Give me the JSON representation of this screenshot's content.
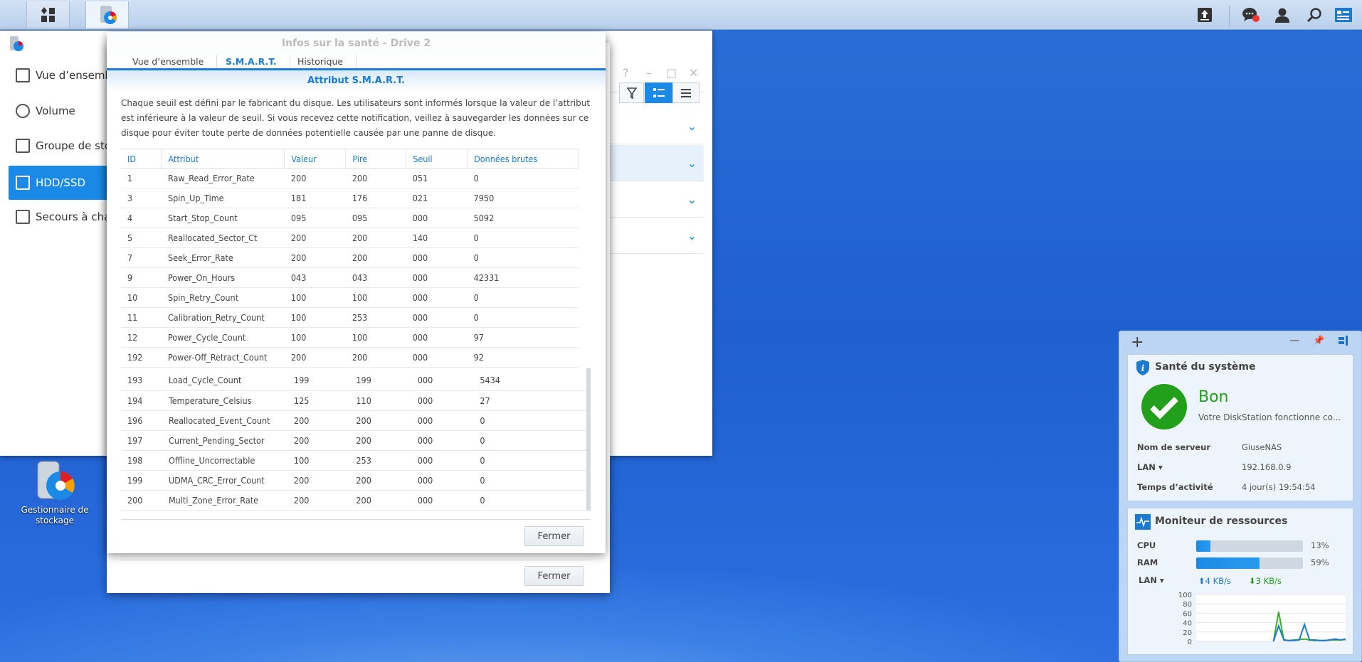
{
  "taskbar": {
    "main_menu": "main-menu",
    "app": "storage-manager"
  },
  "storage_manager": {
    "sidebar": [
      {
        "label": "Vue d’ensemble"
      },
      {
        "label": "Volume"
      },
      {
        "label": "Groupe de stockage"
      },
      {
        "label": "HDD/SSD",
        "selected": true
      },
      {
        "label": "Secours à chaud"
      }
    ],
    "window_controls": [
      "?",
      "–",
      "□",
      "✕"
    ]
  },
  "dialog": {
    "title": "Infos sur la santé - Drive 2",
    "tabs": [
      "Vue d’ensemble",
      "S.M.A.R.T.",
      "Historique"
    ],
    "active_tab": 1,
    "section_title": "Attribut S.M.A.R.T.",
    "description": "Chaque seuil est défini par le fabricant du disque. Les utilisateurs sont informés lorsque la valeur de l’attribut est inférieure à la valeur de seuil. Si vous recevez cette notification, veillez à sauvegarder les données sur ce disque pour éviter toute perte de données potentielle causée par une panne de disque.",
    "columns": [
      "ID",
      "Attribut",
      "Valeur",
      "Pire",
      "Seuil",
      "Données brutes"
    ],
    "rows": [
      [
        "1",
        "Raw_Read_Error_Rate",
        "200",
        "200",
        "051",
        "0"
      ],
      [
        "3",
        "Spin_Up_Time",
        "181",
        "176",
        "021",
        "7950"
      ],
      [
        "4",
        "Start_Stop_Count",
        "095",
        "095",
        "000",
        "5092"
      ],
      [
        "5",
        "Reallocated_Sector_Ct",
        "200",
        "200",
        "140",
        "0"
      ],
      [
        "7",
        "Seek_Error_Rate",
        "200",
        "200",
        "000",
        "0"
      ],
      [
        "9",
        "Power_On_Hours",
        "043",
        "043",
        "000",
        "42331"
      ],
      [
        "10",
        "Spin_Retry_Count",
        "100",
        "100",
        "000",
        "0"
      ],
      [
        "11",
        "Calibration_Retry_Count",
        "100",
        "253",
        "000",
        "0"
      ],
      [
        "12",
        "Power_Cycle_Count",
        "100",
        "100",
        "000",
        "97"
      ],
      [
        "192",
        "Power-Off_Retract_Count",
        "200",
        "200",
        "000",
        "92"
      ]
    ],
    "rows_lower": [
      [
        "193",
        "Load_Cycle_Count",
        "199",
        "199",
        "000",
        "5434"
      ],
      [
        "194",
        "Temperature_Celsius",
        "125",
        "110",
        "000",
        "27"
      ],
      [
        "196",
        "Reallocated_Event_Count",
        "200",
        "200",
        "000",
        "0"
      ],
      [
        "197",
        "Current_Pending_Sector",
        "200",
        "200",
        "000",
        "0"
      ],
      [
        "198",
        "Offline_Uncorrectable",
        "100",
        "253",
        "000",
        "0"
      ],
      [
        "199",
        "UDMA_CRC_Error_Count",
        "200",
        "200",
        "000",
        "0"
      ],
      [
        "200",
        "Multi_Zone_Error_Rate",
        "200",
        "200",
        "000",
        "0"
      ]
    ],
    "close_label": "Fermer",
    "back_close_label": "Fermer"
  },
  "desktop": {
    "icon_label": "Gestionnaire de stockage"
  },
  "widgets": {
    "health": {
      "title": "Santé du système",
      "status": "Bon",
      "status_text": "Votre DiskStation fonctionne co...",
      "server_label": "Nom de serveur",
      "server": "GiuseNAS",
      "lan_label": "LAN",
      "lan_ip": "192.168.0.9",
      "uptime_label": "Temps d’activité",
      "uptime": "4 jour(s) 19:54:54",
      "status_color": "#22a01c"
    },
    "resources": {
      "title": "Moniteur de ressources",
      "cpu_label": "CPU",
      "cpu_pct": 13,
      "cpu_text": "13%",
      "ram_label": "RAM",
      "ram_pct": 59,
      "ram_text": "59%",
      "lan_label": "LAN",
      "up": "4 KB/s",
      "down": "3 KB/s"
    }
  },
  "chart_data": {
    "type": "line",
    "title": "LAN",
    "ylim": [
      0,
      100
    ],
    "yticks": [
      "100",
      "80",
      "60",
      "40",
      "20",
      "0"
    ],
    "series": [
      {
        "name": "upload",
        "color": "#1a7bd0",
        "values": [
          null,
          null,
          null,
          null,
          null,
          null,
          null,
          null,
          null,
          null,
          null,
          null,
          null,
          null,
          null,
          0,
          33,
          3,
          2,
          2,
          3,
          36,
          3,
          3,
          2,
          2,
          3,
          5,
          3,
          5
        ]
      },
      {
        "name": "download",
        "color": "#3cb02a",
        "values": [
          null,
          null,
          null,
          null,
          null,
          null,
          null,
          null,
          null,
          null,
          null,
          null,
          null,
          null,
          null,
          0,
          63,
          3,
          2,
          3,
          4,
          5,
          3,
          2,
          2,
          2,
          3,
          3,
          3,
          4
        ]
      }
    ]
  }
}
